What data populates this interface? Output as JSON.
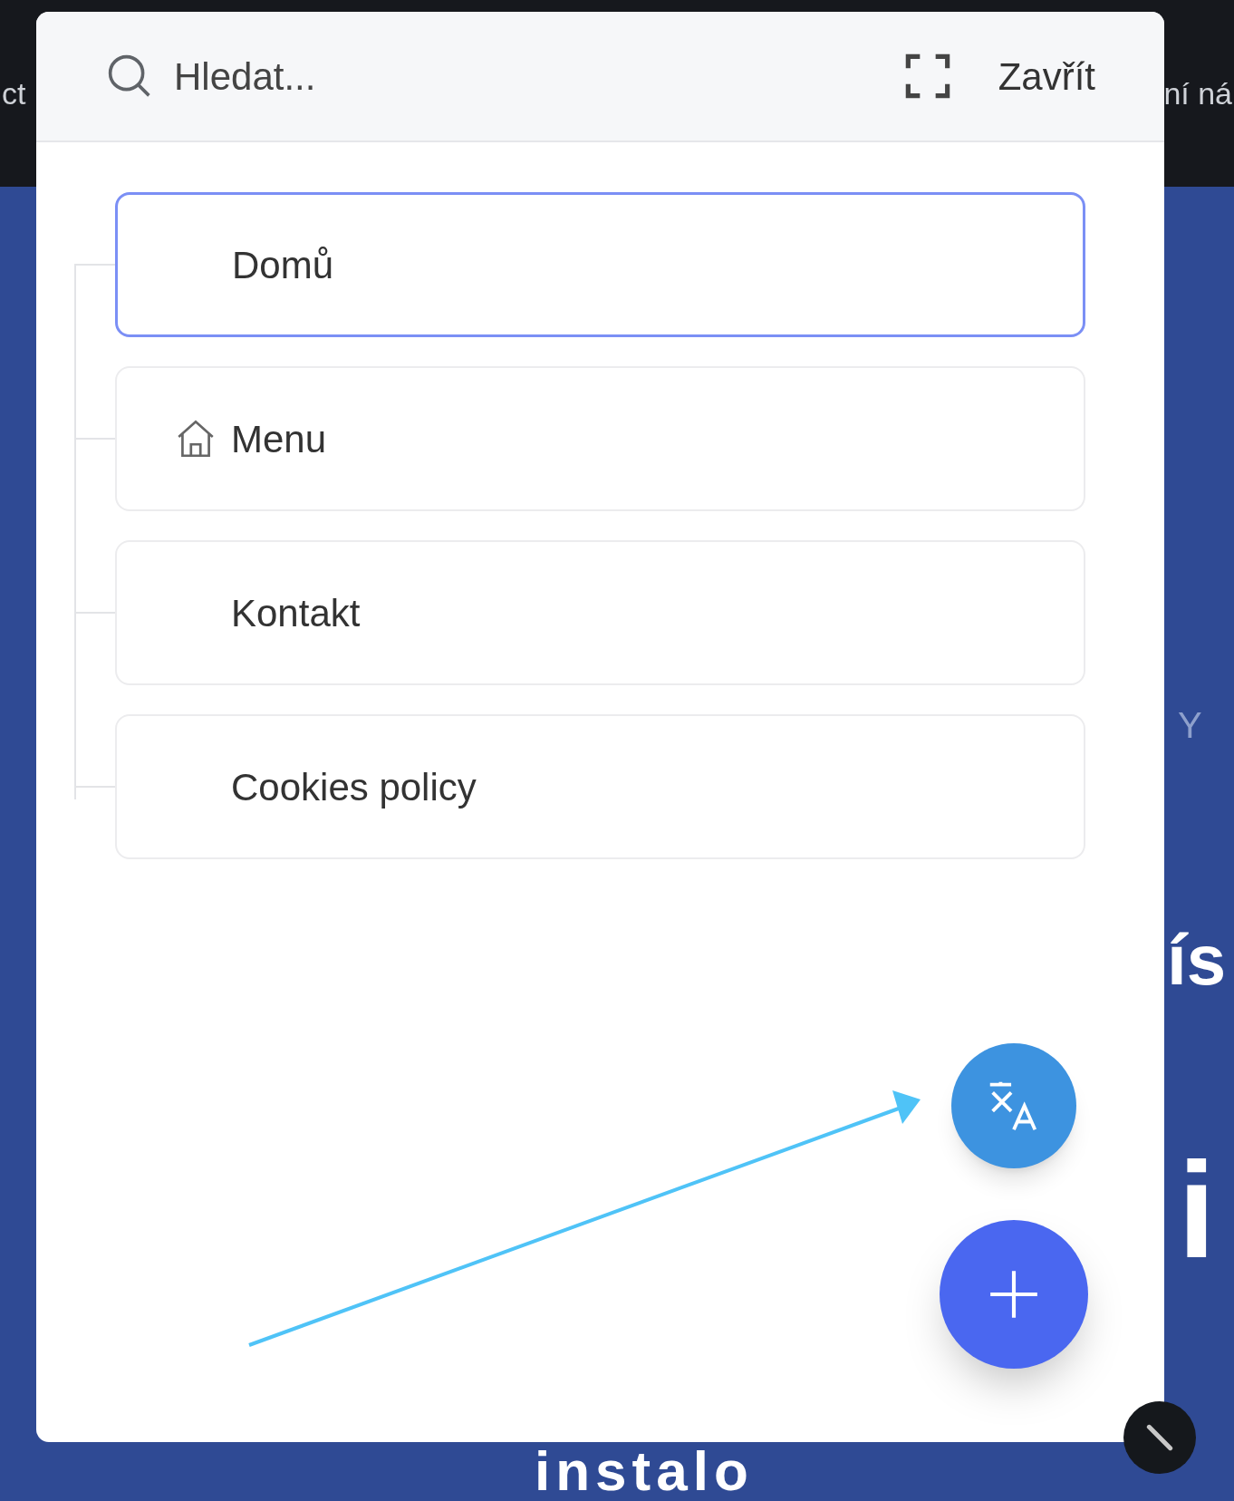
{
  "background": {
    "top_bar_left": "ct",
    "top_bar_right": "ní ná",
    "side_letter": "Y",
    "headline_1": "ís",
    "headline_2": "i",
    "headline_3": "instalo"
  },
  "panel": {
    "search": {
      "placeholder": "Hledat..."
    },
    "close": "Zavřít",
    "items": [
      {
        "label": "Domů",
        "selected": true,
        "kind": "plain"
      },
      {
        "label": "Menu",
        "selected": false,
        "kind": "home"
      },
      {
        "label": "Kontakt",
        "selected": false,
        "kind": "plain"
      },
      {
        "label": "Cookies policy",
        "selected": false,
        "kind": "plain"
      }
    ]
  }
}
